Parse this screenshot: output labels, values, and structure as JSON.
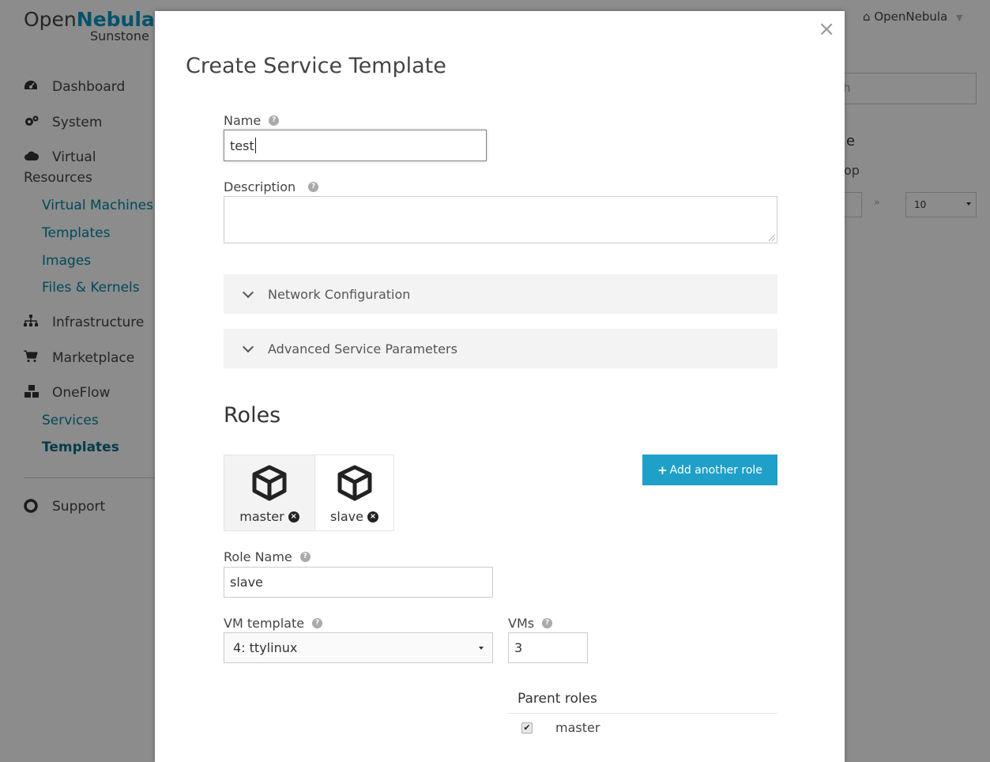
{
  "app": {
    "logo_part1": "Open",
    "logo_part2": "Nebula",
    "logo_sub": "Sunstone",
    "user_menu": "OpenNebula"
  },
  "sidebar": {
    "items": [
      {
        "label": "Dashboard",
        "icon": "dashboard-icon"
      },
      {
        "label": "System",
        "icon": "cogs-icon"
      },
      {
        "label": "Virtual",
        "label2": "Resources",
        "icon": "cloud-icon"
      },
      {
        "label": "Infrastructure",
        "icon": "sitemap-icon"
      },
      {
        "label": "Marketplace",
        "icon": "cart-icon"
      },
      {
        "label": "OneFlow",
        "icon": "cubes-icon"
      },
      {
        "label": "Support",
        "icon": "lifebuoy-icon"
      }
    ],
    "virtual_sub": [
      "Virtual Machines",
      "Templates",
      "Images",
      "Files & Kernels"
    ],
    "oneflow_sub": [
      "Services",
      "Templates"
    ]
  },
  "background": {
    "search_fragment": "h",
    "heading_fragment": "e",
    "text_fragment": "op",
    "pagination_next": "»",
    "page_size": "10"
  },
  "modal": {
    "title": "Create Service Template",
    "close_glyph": "×",
    "name_label": "Name",
    "name_value": "test",
    "description_label": "Description",
    "description_value": "",
    "network_config_label": "Network Configuration",
    "advanced_params_label": "Advanced Service Parameters",
    "roles_heading": "Roles",
    "roles": [
      {
        "name": "master"
      },
      {
        "name": "slave"
      }
    ],
    "add_role_label": "Add another role",
    "role_name_label": "Role Name",
    "role_name_value": "slave",
    "vm_template_label": "VM template",
    "vm_template_value": "4: ttylinux",
    "vms_label": "VMs",
    "vms_value": "3",
    "parent_roles_heading": "Parent roles",
    "parent_roles": [
      {
        "name": "master",
        "checked": true
      }
    ]
  },
  "colors": {
    "accent": "#1fa0c9",
    "link": "#0086a8",
    "overlay": "rgba(0,0,0,0.45)"
  }
}
